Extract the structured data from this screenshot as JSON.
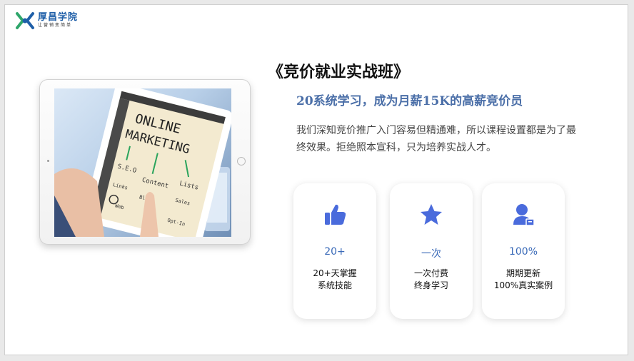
{
  "logo": {
    "name": "厚昌学院",
    "slogan": "让营销变简单"
  },
  "title": "《竞价就业实战班》",
  "subtitle": "20系统学习，成为月薪15K的高薪竞价员",
  "description": "我们深知竞价推广入门容易但精通难，所以课程设置都是为了最终效果。拒绝照本宣科，只为培养实战人才。",
  "tablet_screen": {
    "headline_1": "ONLINE",
    "headline_2": "MARKETING",
    "words": [
      "S.E.O",
      "Content",
      "Lists",
      "Links",
      "Blogs",
      "Sales",
      "Web",
      "Opt-In"
    ]
  },
  "cards": [
    {
      "icon": "thumbs-up-icon",
      "value": "20+",
      "line1": "20+天掌握",
      "line2": "系统技能"
    },
    {
      "icon": "star-icon",
      "value": "一次",
      "line1": "一次付费",
      "line2": "终身学习"
    },
    {
      "icon": "user-badge-icon",
      "value": "100%",
      "line1": "期期更新",
      "line2": "100%真实案例"
    }
  ],
  "colors": {
    "accent": "#4a6bdc",
    "subtitle": "#4b6fa8",
    "value": "#3a6ab8",
    "logo": "#1f5fa8"
  }
}
